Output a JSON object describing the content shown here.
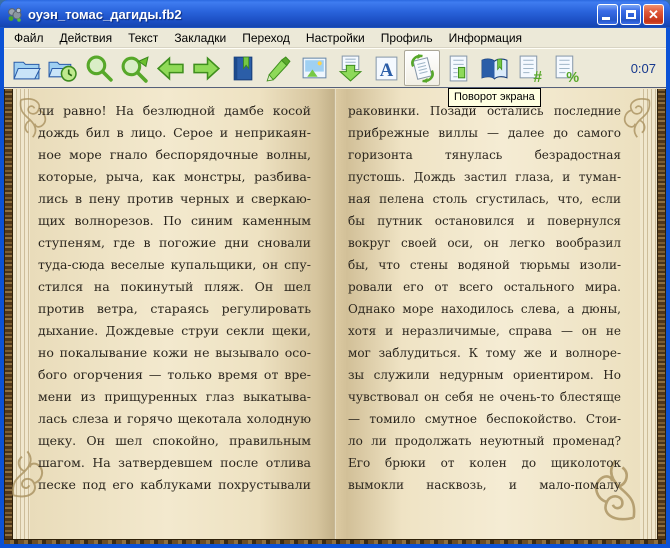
{
  "window": {
    "title": "оуэн_томас_дагиды.fb2"
  },
  "menu": {
    "items": [
      "Файл",
      "Действия",
      "Текст",
      "Закладки",
      "Переход",
      "Настройки",
      "Профиль",
      "Информация"
    ]
  },
  "toolbar": {
    "timer": "0:07",
    "hovered_button": "rotate-screen",
    "buttons": [
      {
        "name": "open-file",
        "icon": "folder-open-icon"
      },
      {
        "name": "recent-files",
        "icon": "folder-history-icon"
      },
      {
        "name": "search",
        "icon": "magnifier-icon"
      },
      {
        "name": "search-next",
        "icon": "magnifier-arrow-icon"
      },
      {
        "name": "back",
        "icon": "arrow-left-icon"
      },
      {
        "name": "forward",
        "icon": "arrow-right-icon"
      },
      {
        "name": "bookmarks",
        "icon": "book-bookmark-icon"
      },
      {
        "name": "highlight",
        "icon": "marker-icon"
      },
      {
        "name": "cover-image",
        "icon": "picture-icon"
      },
      {
        "name": "autoscroll",
        "icon": "arrow-down-document-icon"
      },
      {
        "name": "font-settings",
        "icon": "letter-a-document-icon"
      },
      {
        "name": "rotate-screen",
        "icon": "rotate-document-icon"
      },
      {
        "name": "page-layout",
        "icon": "page-section-icon"
      },
      {
        "name": "book-mode",
        "icon": "open-book-icon"
      },
      {
        "name": "goto-line",
        "icon": "hash-document-icon"
      },
      {
        "name": "goto-percent",
        "icon": "percent-document-icon"
      }
    ]
  },
  "tooltip": {
    "text": "Поворот экрана"
  },
  "book": {
    "left_page_lines": [
      "ли равно! На безлюдной дамбе косой",
      "дождь бил в лицо. Серое и неприкаян-",
      "ное море гнало беспорядочные волны,",
      "которые, рыча, как монстры, разбива-",
      "лись в пену против черных и сверкаю-",
      "щих волнорезов. По синим каменным",
      "ступеням, где в погожие дни сновали",
      "туда-сюда веселые купальщики, он спу-",
      "стился на покинутый пляж. Он шел",
      "против ветра, стараясь регулировать",
      "дыхание. Дождевые струи секли щеки,",
      "но покалывание кожи не вызывало осо-",
      "бого огорчения — только время от вре-",
      "мени из прищуренных глаз выкатыва-",
      "лась слеза и горячо щекотала холодную",
      "щеку. Он шел спокойно, правильным",
      "шагом. На затвердевшем после отлива",
      "песке под его каблуками похрустывали"
    ],
    "right_page_lines": [
      "раковинки. Позади остались последние",
      "прибрежные виллы — далее до самого",
      "горизонта тянулась безрадостная",
      "пустошь. Дождь застил глаза, и туман-",
      "ная пелена столь сгустилась, что, если",
      "бы путник остановился и повернулся",
      "вокруг своей оси, он легко вообразил",
      "бы, что стены водяной тюрьмы изоли-",
      "ровали его от всего остального мира.",
      "Однако море находилось слева, а дюны,",
      "хотя и неразличимые, справа — он не",
      "мог заблудиться. К тому же и волноре-",
      "зы служили недурным ориентиром. Но",
      "чувствовал он себя не очень-то блестяще",
      "— томило смутное беспокойство. Стои-",
      "ло ли продолжать неуютный променад?",
      "Его брюки от колен до щиколоток",
      "вымокли насквозь, и мало-помалу"
    ]
  },
  "colors": {
    "titlebar_blue": "#2a64dc",
    "window_border": "#0c52d6",
    "chrome_beige": "#ece9d8",
    "page_cream": "#f3e9ce",
    "ornament_gold": "#a9915f",
    "tooltip_bg": "#ffffe1",
    "timer_text": "#16388e",
    "accent_green": "#57a82a"
  }
}
